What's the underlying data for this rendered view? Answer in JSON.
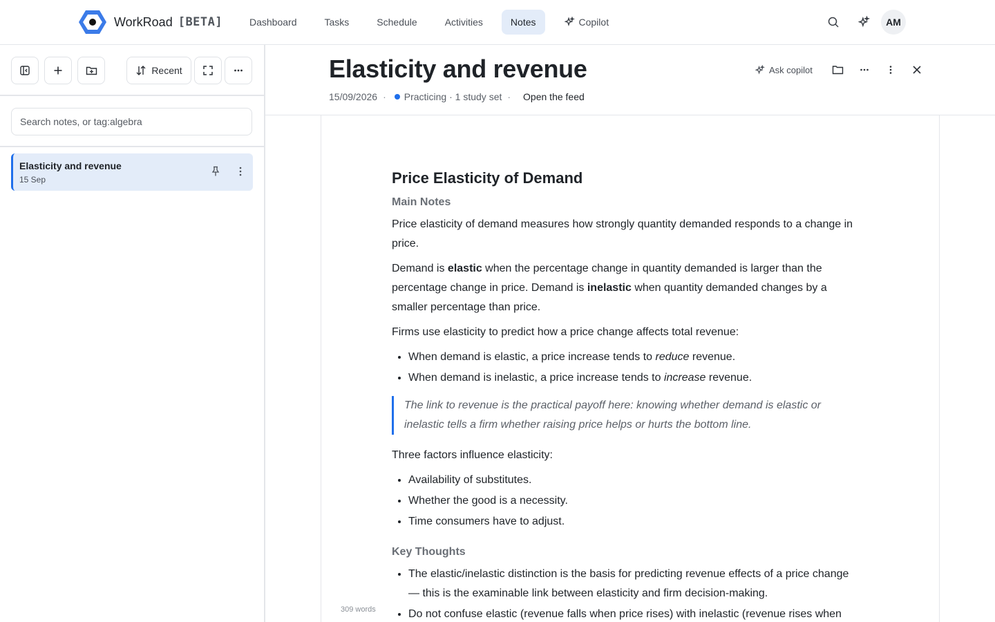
{
  "brand": {
    "name": "WorkRoad",
    "badge": "[BETA]",
    "accent": "#3b7be8"
  },
  "nav": {
    "items": [
      {
        "label": "Dashboard",
        "icon": ""
      },
      {
        "label": "Tasks",
        "icon": ""
      },
      {
        "label": "Schedule",
        "icon": ""
      },
      {
        "label": "Activities",
        "icon": ""
      },
      {
        "label": "Notes",
        "icon": "",
        "active": true
      },
      {
        "label": "Copilot",
        "icon": "sparkle-icon"
      }
    ],
    "right_icons": [
      "search-icon",
      "sparkle-icon"
    ],
    "avatar_initials": "AM"
  },
  "sidebar": {
    "toolbar": {
      "sort_label": "Recent"
    },
    "search": {
      "placeholder": "Search notes, or tag:algebra",
      "value": ""
    },
    "notes": [
      {
        "title": "Elasticity and revenue",
        "date": "15 Sep",
        "selected": true
      }
    ]
  },
  "document": {
    "title": "Elasticity and revenue",
    "date": "15/09/2026",
    "status": "Practicing · 1 study set",
    "feed_link": "Open the feed",
    "ask_copilot_label": "Ask copilot",
    "heading": "Price Elasticity of Demand",
    "section1_title": "Main Notes",
    "p1": "Price elasticity of demand measures how strongly quantity demanded responds to a change in price.",
    "p2": {
      "a": "Demand is ",
      "b": "elastic",
      "c": " when the percentage change in quantity demanded is larger than the percentage change in price. Demand is ",
      "d": "inelastic",
      "e": " when quantity demanded changes by a smaller percentage than price."
    },
    "p3": "Firms use elasticity to predict how a price change affects total revenue:",
    "list1": [
      {
        "a": "When demand is elastic, a price increase tends to ",
        "em": "reduce",
        "b": " revenue."
      },
      {
        "a": "When demand is inelastic, a price increase tends to ",
        "em": "increase",
        "b": " revenue."
      }
    ],
    "quote": "The link to revenue is the practical payoff here: knowing whether demand is elastic or inelastic tells a firm whether raising price helps or hurts the bottom line.",
    "p4": "Three factors influence elasticity:",
    "list2": [
      "Availability of substitutes.",
      "Whether the good is a necessity.",
      "Time consumers have to adjust."
    ],
    "section2_title": "Key Thoughts",
    "list3": [
      "The elastic/inelastic distinction is the basis for predicting revenue effects of a price change — this is the examinable link between elasticity and firm decision-making.",
      "Do not confuse elastic (revenue falls when price rises) with inelastic (revenue rises when"
    ],
    "word_count": "309 words"
  }
}
